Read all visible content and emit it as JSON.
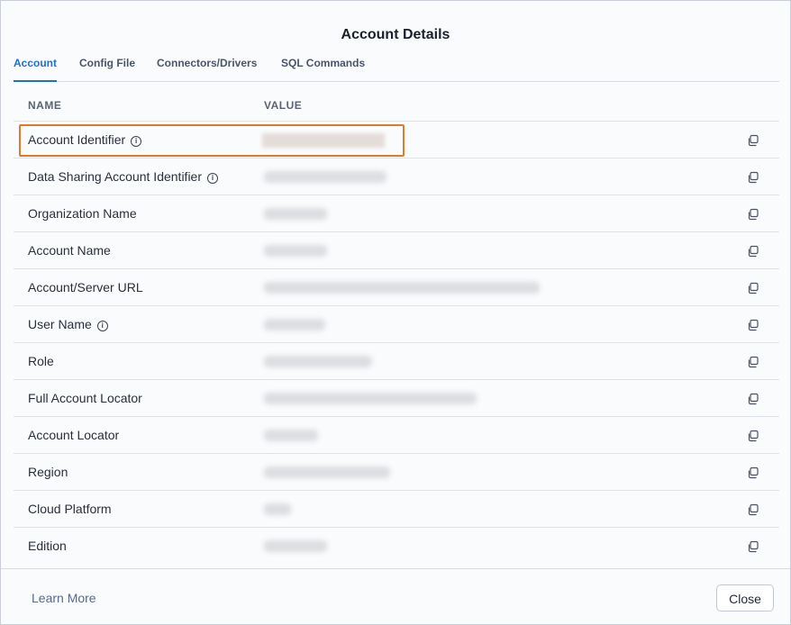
{
  "dialog": {
    "title": "Account Details"
  },
  "tabs": [
    {
      "label": "Account",
      "active": true
    },
    {
      "label": "Config File",
      "active": false
    },
    {
      "label": "Connectors/Drivers",
      "active": false
    },
    {
      "label": "SQL Commands",
      "active": false
    }
  ],
  "table": {
    "columns": [
      "NAME",
      "VALUE"
    ],
    "rows": [
      {
        "label": "Account Identifier",
        "info": true
      },
      {
        "label": "Data Sharing Account Identifier",
        "info": true
      },
      {
        "label": "Organization Name",
        "info": false
      },
      {
        "label": "Account Name",
        "info": false
      },
      {
        "label": "Account/Server URL",
        "info": false
      },
      {
        "label": "User Name",
        "info": true
      },
      {
        "label": "Role",
        "info": false
      },
      {
        "label": "Full Account Locator",
        "info": false
      },
      {
        "label": "Account Locator",
        "info": false
      },
      {
        "label": "Region",
        "info": false
      },
      {
        "label": "Cloud Platform",
        "info": false
      },
      {
        "label": "Edition",
        "info": false
      }
    ]
  },
  "icons": {
    "info": "info-circle-icon",
    "copy": "copy-icon"
  },
  "footer": {
    "learn_more": "Learn More",
    "close": "Close"
  },
  "colors": {
    "accent": "#1f6fd1",
    "highlight": "#e07b2c"
  }
}
